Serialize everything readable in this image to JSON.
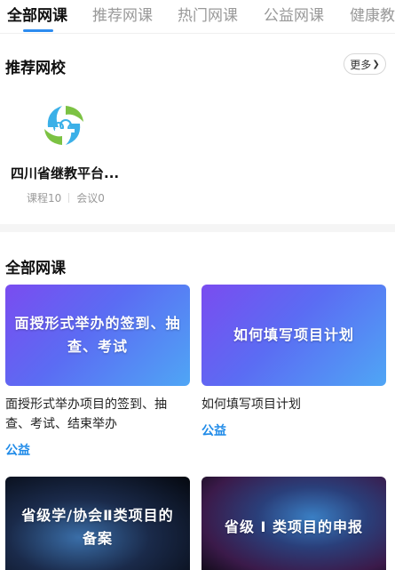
{
  "tabs": [
    {
      "label": "全部网课",
      "active": true
    },
    {
      "label": "推荐网课",
      "active": false
    },
    {
      "label": "热门网课",
      "active": false
    },
    {
      "label": "公益网课",
      "active": false
    },
    {
      "label": "健康教",
      "active": false
    }
  ],
  "recommended": {
    "title": "推荐网校",
    "more_label": "更多",
    "school": {
      "name": "四川省继教平台...",
      "courses_label": "课程10",
      "meetings_label": "会议0"
    }
  },
  "all_courses": {
    "title": "全部网课",
    "items": [
      {
        "thumb_text": "面授形式举办的签到、抽查、考试",
        "title": "面授形式举办项目的签到、抽查、考试、结束举办",
        "tag": "公益"
      },
      {
        "thumb_text": "如何填写项目计划",
        "title": "如何填写项目计划",
        "tag": "公益"
      },
      {
        "thumb_text": "省级学/协会Ⅱ类项目的备案",
        "title": "",
        "tag": ""
      },
      {
        "thumb_text": "省级 I 类项目的申报",
        "title": "",
        "tag": ""
      }
    ]
  },
  "colors": {
    "accent": "#2d8cf0",
    "tag": "#1e8ae8"
  }
}
